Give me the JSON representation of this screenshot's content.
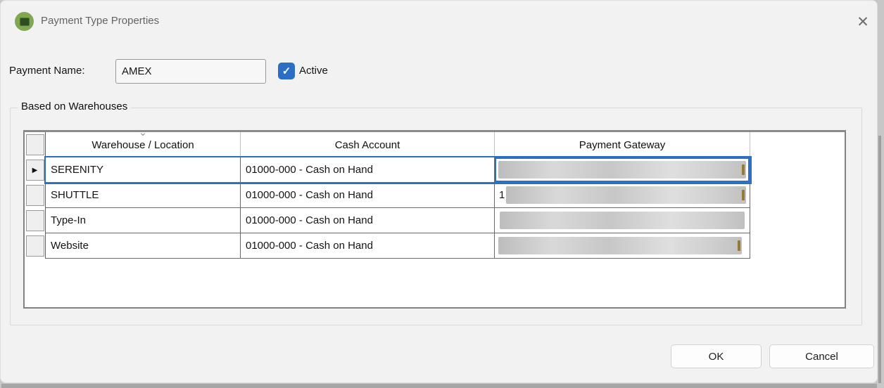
{
  "window": {
    "title": "Payment Type Properties"
  },
  "icons": {
    "close": "✕",
    "check": "✓",
    "row_indicator": "▶",
    "sort_chevron": "⌄"
  },
  "form": {
    "payment_name_label": "Payment Name:",
    "payment_name_value": "AMEX",
    "active_label": "Active",
    "active_checked": true
  },
  "group": {
    "label": "Based on Warehouses"
  },
  "table": {
    "columns": [
      "Warehouse / Location",
      "Cash Account",
      "Payment Gateway"
    ],
    "rows": [
      {
        "warehouse": "SERENITY",
        "cash_account": "01000-000 - Cash on Hand",
        "payment_gateway_redacted": true,
        "selected": true
      },
      {
        "warehouse": "SHUTTLE",
        "cash_account": "01000-000 - Cash on Hand",
        "payment_gateway_prefix": "1",
        "payment_gateway_redacted": true
      },
      {
        "warehouse": "Type-In",
        "cash_account": "01000-000 - Cash on Hand",
        "payment_gateway_redacted": true
      },
      {
        "warehouse": "Website",
        "cash_account": "01000-000 - Cash on Hand",
        "payment_gateway_redacted": true
      }
    ]
  },
  "footer": {
    "ok": "OK",
    "cancel": "Cancel"
  },
  "colors": {
    "accent_blue": "#2a6fc4",
    "app_icon_green": "#7fa851",
    "app_icon_dark_green": "#2f4d1f",
    "dialog_background": "#f2f2f2"
  }
}
